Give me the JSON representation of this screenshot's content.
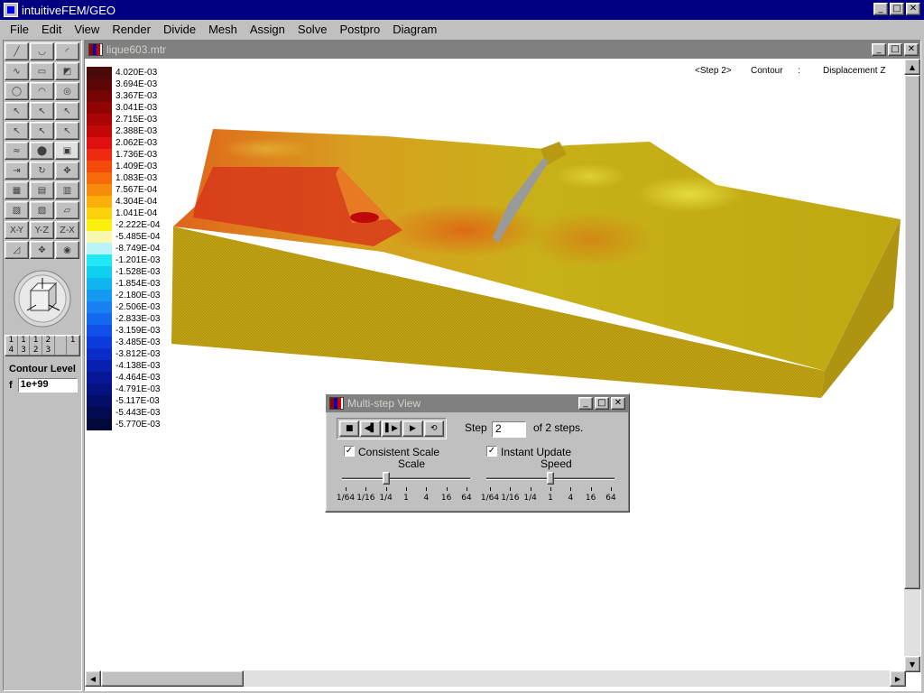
{
  "app": {
    "title": "intuitiveFEM/GEO",
    "window_buttons": [
      "_",
      "□",
      "✕"
    ]
  },
  "menu": [
    "File",
    "Edit",
    "View",
    "Render",
    "Divide",
    "Mesh",
    "Assign",
    "Solve",
    "Postpro",
    "Diagram"
  ],
  "toolbox": {
    "tools": [
      {
        "name": "line-tool-icon",
        "glyph": "╱"
      },
      {
        "name": "arc-tool-icon",
        "glyph": "◡"
      },
      {
        "name": "curve-tool-icon",
        "glyph": "◜"
      },
      {
        "name": "spline-tool-icon",
        "glyph": "∿"
      },
      {
        "name": "rectangle-tool-icon",
        "glyph": "▭"
      },
      {
        "name": "surface-tool-icon",
        "glyph": "◩"
      },
      {
        "name": "circle-tool-icon",
        "glyph": "◯"
      },
      {
        "name": "dome-tool-icon",
        "glyph": "◠"
      },
      {
        "name": "torus-tool-icon",
        "glyph": "◎"
      },
      {
        "name": "select-tool-icon",
        "glyph": "↖"
      },
      {
        "name": "select-edge-tool-icon",
        "glyph": "↖"
      },
      {
        "name": "select-face-tool-icon",
        "glyph": "↖"
      },
      {
        "name": "select-node-tool-icon",
        "glyph": "↖"
      },
      {
        "name": "select-element-tool-icon",
        "glyph": "↖"
      },
      {
        "name": "select-solid-tool-icon",
        "glyph": "↖"
      },
      {
        "name": "wave-tool-icon",
        "glyph": "≈"
      },
      {
        "name": "blob-tool-icon",
        "glyph": "⬤"
      },
      {
        "name": "window-select-tool-icon",
        "glyph": "▣"
      },
      {
        "name": "move-tool-icon",
        "glyph": "⇥"
      },
      {
        "name": "rotate-tool-icon",
        "glyph": "↻"
      },
      {
        "name": "pan-tool-icon",
        "glyph": "✥"
      },
      {
        "name": "wire-box-tool-icon",
        "glyph": "▦"
      },
      {
        "name": "solid-box-tool-icon",
        "glyph": "▤"
      },
      {
        "name": "shaded-box-tool-icon",
        "glyph": "▥"
      },
      {
        "name": "mesh-box-tool-icon",
        "glyph": "▧"
      },
      {
        "name": "mesh-box2-tool-icon",
        "glyph": "▨"
      },
      {
        "name": "plane-tool-icon",
        "glyph": "▱"
      },
      {
        "name": "view-xy-button",
        "glyph": "X-Y"
      },
      {
        "name": "view-yz-button",
        "glyph": "Y-Z"
      },
      {
        "name": "view-zx-button",
        "glyph": "Z-X"
      },
      {
        "name": "iso-view-tool-icon",
        "glyph": "◿"
      },
      {
        "name": "zoom-extents-tool-icon",
        "glyph": "✥"
      },
      {
        "name": "point-tool-icon",
        "glyph": "◉"
      }
    ],
    "layer_strip": [
      {
        "top": "1",
        "bottom": "4"
      },
      {
        "top": "1",
        "bottom": "3"
      },
      {
        "top": "1",
        "bottom": "2"
      },
      {
        "top": "2",
        "bottom": "3"
      },
      {
        "top": "",
        "bottom": ""
      },
      {
        "top": "",
        "bottom": "1"
      }
    ],
    "contour_level_label": "Contour Level",
    "contour_prefix": "f",
    "contour_value": "1e+99"
  },
  "child_window": {
    "title": "lique603.mtr",
    "header": {
      "step": "<Step 2>",
      "mode": "Contour",
      "separator": ":",
      "quantity": "Displacement Z"
    }
  },
  "legend": [
    {
      "label": "4.020E-03",
      "color": "#4a0a0a"
    },
    {
      "label": "3.694E-03",
      "color": "#5c0606"
    },
    {
      "label": "3.367E-03",
      "color": "#760404"
    },
    {
      "label": "3.041E-03",
      "color": "#900404"
    },
    {
      "label": "2.715E-03",
      "color": "#aa0404"
    },
    {
      "label": "2.388E-03",
      "color": "#c40808"
    },
    {
      "label": "2.062E-03",
      "color": "#de1010"
    },
    {
      "label": "1.736E-03",
      "color": "#f02a10"
    },
    {
      "label": "1.409E-03",
      "color": "#f44a0c"
    },
    {
      "label": "1.083E-03",
      "color": "#f66a0a"
    },
    {
      "label": "7.567E-04",
      "color": "#f88c0a"
    },
    {
      "label": "4.304E-04",
      "color": "#fcae0a"
    },
    {
      "label": "1.041E-04",
      "color": "#fcd20c"
    },
    {
      "label": "-2.222E-04",
      "color": "#fcf00e"
    },
    {
      "label": "-5.485E-04",
      "color": "#f8f8b0"
    },
    {
      "label": "-8.749E-04",
      "color": "#b8f4f8"
    },
    {
      "label": "-1.201E-03",
      "color": "#20e8f4"
    },
    {
      "label": "-1.528E-03",
      "color": "#10d0f0"
    },
    {
      "label": "-1.854E-03",
      "color": "#10b4ee"
    },
    {
      "label": "-2.180E-03",
      "color": "#149af0"
    },
    {
      "label": "-2.506E-03",
      "color": "#1880f0"
    },
    {
      "label": "-2.833E-03",
      "color": "#1468ee"
    },
    {
      "label": "-3.159E-03",
      "color": "#1050e8"
    },
    {
      "label": "-3.485E-03",
      "color": "#0c3cdc"
    },
    {
      "label": "-3.812E-03",
      "color": "#0a2cc8"
    },
    {
      "label": "-4.138E-03",
      "color": "#0820b0"
    },
    {
      "label": "-4.464E-03",
      "color": "#061898"
    },
    {
      "label": "-4.791E-03",
      "color": "#041280"
    },
    {
      "label": "-5.117E-03",
      "color": "#040e68"
    },
    {
      "label": "-5.443E-03",
      "color": "#040a50"
    },
    {
      "label": "-5.770E-03",
      "color": "#02083a"
    }
  ],
  "dialog": {
    "title": "Multi-step View",
    "step_label": "Step",
    "step_value": "2",
    "step_suffix": "of 2 steps.",
    "consistent_scale_label": "Consistent Scale",
    "consistent_scale_checked": true,
    "instant_update_label": "Instant Update",
    "instant_update_checked": true,
    "scale_label": "Scale",
    "speed_label": "Speed",
    "scale_ticks": [
      "1/64",
      "1/16",
      "1/4",
      "1",
      "4",
      "16",
      "64"
    ],
    "speed_ticks": [
      "1/64",
      "1/16",
      "1/4",
      "1",
      "4",
      "16",
      "64"
    ],
    "scale_value": "1/4",
    "speed_value": "1",
    "play_buttons": [
      {
        "name": "stop-button",
        "glyph": "■"
      },
      {
        "name": "step-back-button",
        "glyph": "◀▌"
      },
      {
        "name": "step-forward-button",
        "glyph": "▌▶"
      },
      {
        "name": "play-button",
        "glyph": "▶"
      },
      {
        "name": "loop-button",
        "glyph": "⟲"
      }
    ]
  }
}
